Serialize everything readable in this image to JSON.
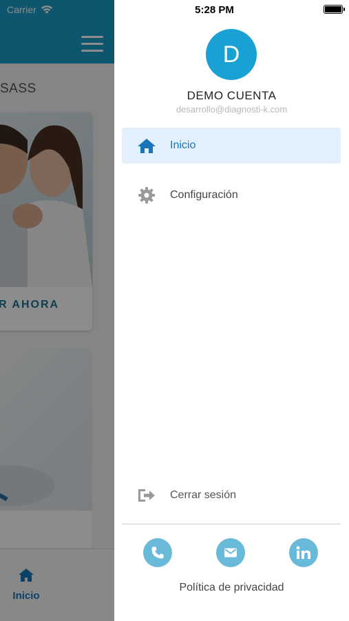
{
  "status_bar": {
    "carrier": "Carrier",
    "time": "5:28 PM"
  },
  "background_app": {
    "subtitle": "SASS",
    "card1_button": "R AHORA",
    "bottom_tab_label": "Inicio"
  },
  "drawer": {
    "avatar_initial": "D",
    "user_name": "DEMO CUENTA",
    "user_email": "desarrollo@diagnosti-k.com",
    "menu": [
      {
        "label": "Inicio",
        "icon": "home-icon",
        "active": true
      },
      {
        "label": "Configuración",
        "icon": "gear-icon",
        "active": false
      }
    ],
    "logout_label": "Cerrar sesión",
    "social": [
      {
        "icon": "phone-icon"
      },
      {
        "icon": "mail-icon"
      },
      {
        "icon": "linkedin-icon"
      }
    ],
    "privacy_label": "Política de privacidad"
  },
  "colors": {
    "brand": "#1a9dc6",
    "avatar": "#1aa1d3",
    "active_item_bg": "#e2effd",
    "active_item_text": "#1a75b8",
    "social_button": "#69b9d8"
  }
}
